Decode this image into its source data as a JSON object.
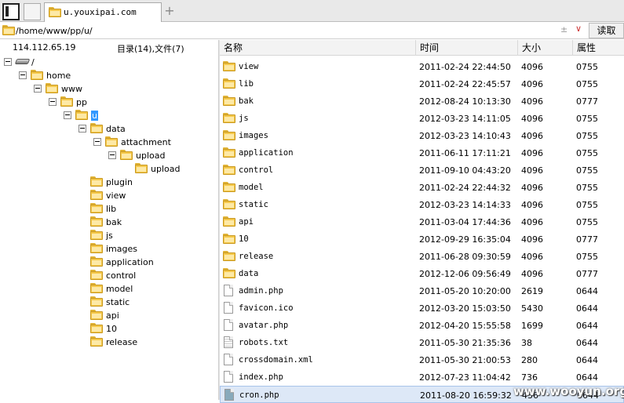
{
  "tabs": [
    {
      "label": "u.youxipai.com"
    }
  ],
  "address": {
    "path": "/home/www/pp/u/",
    "plusminus": "±",
    "read_label": "读取"
  },
  "left_header": {
    "ip": "114.112.65.19",
    "counts": "目录(14),文件(7)"
  },
  "tree": [
    {
      "label": "/",
      "depth": 0,
      "expanded": true,
      "icon": "drive-icon"
    },
    {
      "label": "home",
      "depth": 1,
      "expanded": true
    },
    {
      "label": "www",
      "depth": 2,
      "expanded": true
    },
    {
      "label": "pp",
      "depth": 3,
      "expanded": true
    },
    {
      "label": "u",
      "depth": 4,
      "expanded": true,
      "selected": true
    },
    {
      "label": "data",
      "depth": 5,
      "expanded": true
    },
    {
      "label": "attachment",
      "depth": 6,
      "expanded": true
    },
    {
      "label": "upload",
      "depth": 7,
      "expanded": true
    },
    {
      "label": "upload",
      "depth": 8
    },
    {
      "label": "plugin",
      "depth": 5
    },
    {
      "label": "view",
      "depth": 5
    },
    {
      "label": "lib",
      "depth": 5
    },
    {
      "label": "bak",
      "depth": 5
    },
    {
      "label": "js",
      "depth": 5
    },
    {
      "label": "images",
      "depth": 5
    },
    {
      "label": "application",
      "depth": 5
    },
    {
      "label": "control",
      "depth": 5
    },
    {
      "label": "model",
      "depth": 5
    },
    {
      "label": "static",
      "depth": 5
    },
    {
      "label": "api",
      "depth": 5
    },
    {
      "label": "10",
      "depth": 5
    },
    {
      "label": "release",
      "depth": 5
    }
  ],
  "columns": {
    "name": "名称",
    "time": "时间",
    "size": "大小",
    "attr": "属性"
  },
  "files": [
    {
      "name": "view",
      "time": "2011-02-24 22:44:50",
      "size": "4096",
      "attr": "0755",
      "type": "folder"
    },
    {
      "name": "lib",
      "time": "2011-02-24 22:45:57",
      "size": "4096",
      "attr": "0755",
      "type": "folder"
    },
    {
      "name": "bak",
      "time": "2012-08-24 10:13:30",
      "size": "4096",
      "attr": "0777",
      "type": "folder"
    },
    {
      "name": "js",
      "time": "2012-03-23 14:11:05",
      "size": "4096",
      "attr": "0755",
      "type": "folder"
    },
    {
      "name": "images",
      "time": "2012-03-23 14:10:43",
      "size": "4096",
      "attr": "0755",
      "type": "folder"
    },
    {
      "name": "application",
      "time": "2011-06-11 17:11:21",
      "size": "4096",
      "attr": "0755",
      "type": "folder"
    },
    {
      "name": "control",
      "time": "2011-09-10 04:43:20",
      "size": "4096",
      "attr": "0755",
      "type": "folder"
    },
    {
      "name": "model",
      "time": "2011-02-24 22:44:32",
      "size": "4096",
      "attr": "0755",
      "type": "folder"
    },
    {
      "name": "static",
      "time": "2012-03-23 14:14:33",
      "size": "4096",
      "attr": "0755",
      "type": "folder"
    },
    {
      "name": "api",
      "time": "2011-03-04 17:44:36",
      "size": "4096",
      "attr": "0755",
      "type": "folder"
    },
    {
      "name": "10",
      "time": "2012-09-29 16:35:04",
      "size": "4096",
      "attr": "0777",
      "type": "folder"
    },
    {
      "name": "release",
      "time": "2011-06-28 09:30:59",
      "size": "4096",
      "attr": "0755",
      "type": "folder"
    },
    {
      "name": "data",
      "time": "2012-12-06 09:56:49",
      "size": "4096",
      "attr": "0777",
      "type": "folder"
    },
    {
      "name": "admin.php",
      "time": "2011-05-20 10:20:00",
      "size": "2619",
      "attr": "0644",
      "type": "file"
    },
    {
      "name": "favicon.ico",
      "time": "2012-03-20 15:03:50",
      "size": "5430",
      "attr": "0644",
      "type": "file"
    },
    {
      "name": "avatar.php",
      "time": "2012-04-20 15:55:58",
      "size": "1699",
      "attr": "0644",
      "type": "file"
    },
    {
      "name": "robots.txt",
      "time": "2011-05-30 21:35:36",
      "size": "38",
      "attr": "0644",
      "type": "text"
    },
    {
      "name": "crossdomain.xml",
      "time": "2011-05-30 21:00:53",
      "size": "280",
      "attr": "0644",
      "type": "file"
    },
    {
      "name": "index.php",
      "time": "2012-07-23 11:04:42",
      "size": "736",
      "attr": "0644",
      "type": "file"
    },
    {
      "name": "cron.php",
      "time": "2011-08-20 16:59:32",
      "size": "436",
      "attr": "0644",
      "type": "cron",
      "highlighted": true
    }
  ],
  "watermark": "www.wooyun.org"
}
